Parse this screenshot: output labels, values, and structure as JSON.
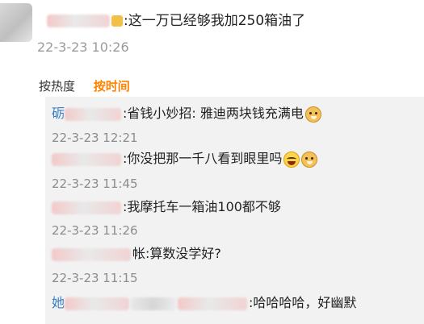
{
  "top_comment": {
    "text": ":这一万已经够我加250箱油了",
    "time": "22-3-23 10:26"
  },
  "sort_tabs": {
    "hot_label": "按热度",
    "time_label": "按时间"
  },
  "replies": [
    {
      "lead": "砺",
      "text": ":省钱小妙招: 雅迪两块钱充满电",
      "time": "22-3-23 12:21",
      "emojis": [
        "doge"
      ]
    },
    {
      "lead": "",
      "text": ":你没把那一千八看到眼里吗",
      "time": "22-3-23 11:45",
      "emojis": [
        "laugh",
        "doge"
      ]
    },
    {
      "lead": "",
      "text": ":我摩托车一箱油100都不够",
      "time": "22-3-23 11:26",
      "emojis": []
    },
    {
      "lead": "",
      "text": "帐:算数没学好?",
      "time": "22-3-23 11:15",
      "emojis": []
    },
    {
      "lead": "她",
      "text": ":哈哈哈哈，好幽默",
      "time": "",
      "emojis": []
    }
  ]
}
